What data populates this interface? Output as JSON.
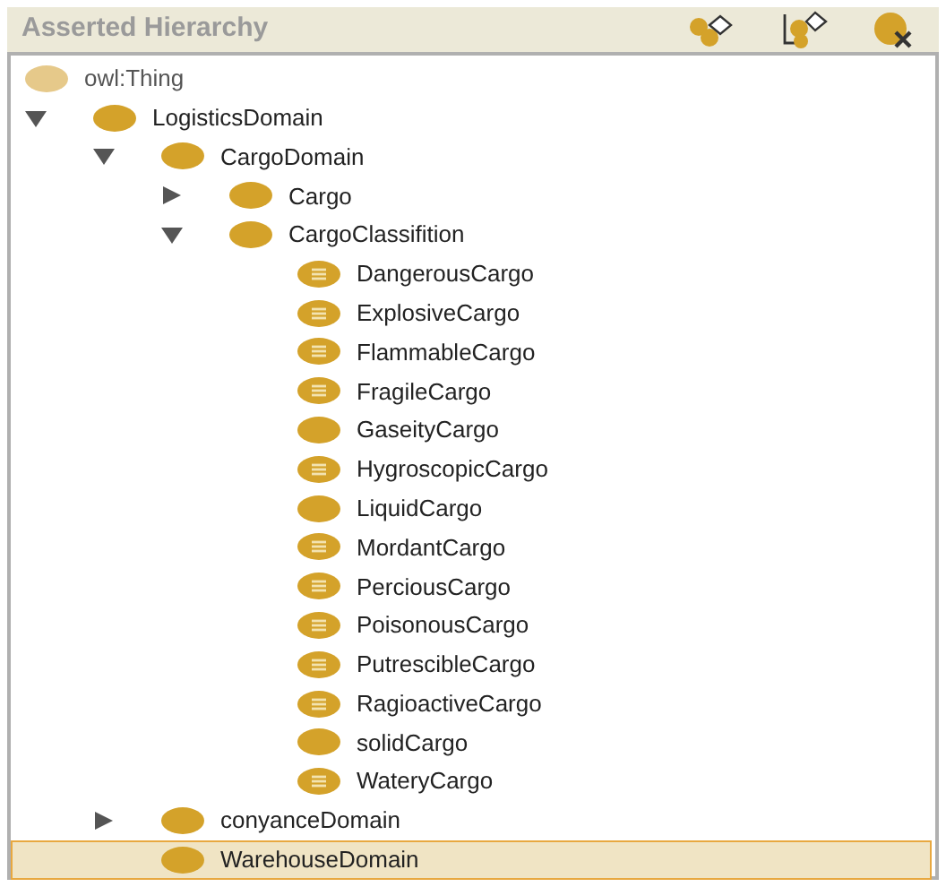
{
  "panel": {
    "title": "Asserted Hierarchy"
  },
  "tree": [
    {
      "label": "owl:Thing",
      "kind": "thing",
      "selected": false,
      "children": [
        {
          "label": "LogisticsDomain",
          "kind": "class",
          "selected": false,
          "expanded": true,
          "children": [
            {
              "label": "CargoDomain",
              "kind": "class",
              "selected": false,
              "expanded": true,
              "children": [
                {
                  "label": "Cargo",
                  "kind": "class",
                  "selected": false,
                  "expanded": false
                },
                {
                  "label": "CargoClassifition",
                  "kind": "class",
                  "selected": false,
                  "expanded": true,
                  "children": [
                    {
                      "label": "DangerousCargo",
                      "kind": "defined",
                      "selected": false
                    },
                    {
                      "label": "ExplosiveCargo",
                      "kind": "defined",
                      "selected": false
                    },
                    {
                      "label": "FlammableCargo",
                      "kind": "defined",
                      "selected": false
                    },
                    {
                      "label": "FragileCargo",
                      "kind": "defined",
                      "selected": false
                    },
                    {
                      "label": "GaseityCargo",
                      "kind": "class",
                      "selected": false
                    },
                    {
                      "label": "HygroscopicCargo",
                      "kind": "defined",
                      "selected": false
                    },
                    {
                      "label": "LiquidCargo",
                      "kind": "class",
                      "selected": false
                    },
                    {
                      "label": "MordantCargo",
                      "kind": "defined",
                      "selected": false
                    },
                    {
                      "label": "PerciousCargo",
                      "kind": "defined",
                      "selected": false
                    },
                    {
                      "label": "PoisonousCargo",
                      "kind": "defined",
                      "selected": false
                    },
                    {
                      "label": "PutrescibleCargo",
                      "kind": "defined",
                      "selected": false
                    },
                    {
                      "label": "RagioactiveCargo",
                      "kind": "defined",
                      "selected": false
                    },
                    {
                      "label": "solidCargo",
                      "kind": "class",
                      "selected": false
                    },
                    {
                      "label": "WateryCargo",
                      "kind": "defined",
                      "selected": false
                    }
                  ]
                }
              ]
            },
            {
              "label": "conyanceDomain",
              "kind": "class",
              "selected": false,
              "expanded": false
            },
            {
              "label": "WarehouseDomain",
              "kind": "class",
              "selected": true
            }
          ]
        }
      ]
    }
  ]
}
